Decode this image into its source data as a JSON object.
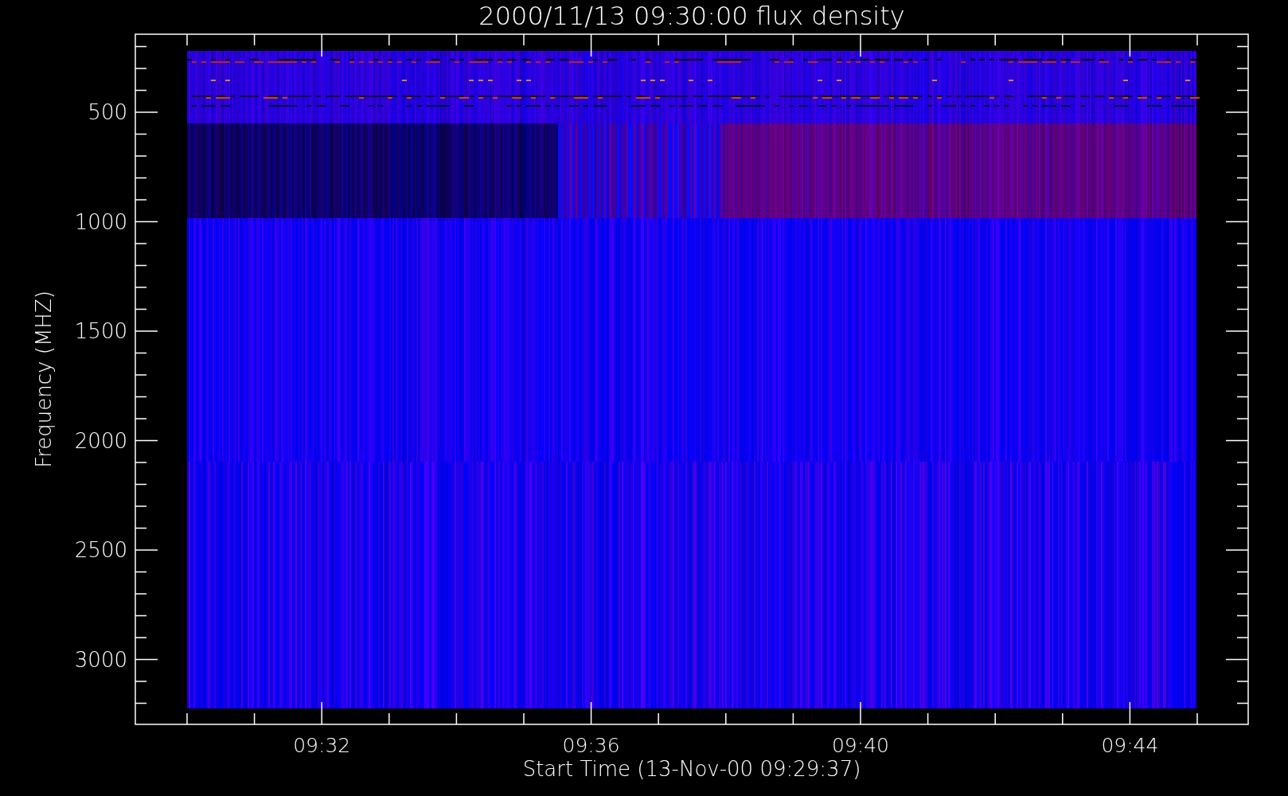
{
  "plot": {
    "title": "2000/11/13 09:30:00 flux density",
    "y_axis": {
      "label": "Frequency (MHZ)",
      "ticks": [
        "500",
        "1000",
        "1500",
        "2000",
        "2500",
        "3000"
      ]
    },
    "x_axis": {
      "label": "Start Time (13-Nov-00 09:29:37)",
      "ticks": [
        "09:32",
        "09:36",
        "09:40",
        "09:44"
      ]
    }
  }
}
